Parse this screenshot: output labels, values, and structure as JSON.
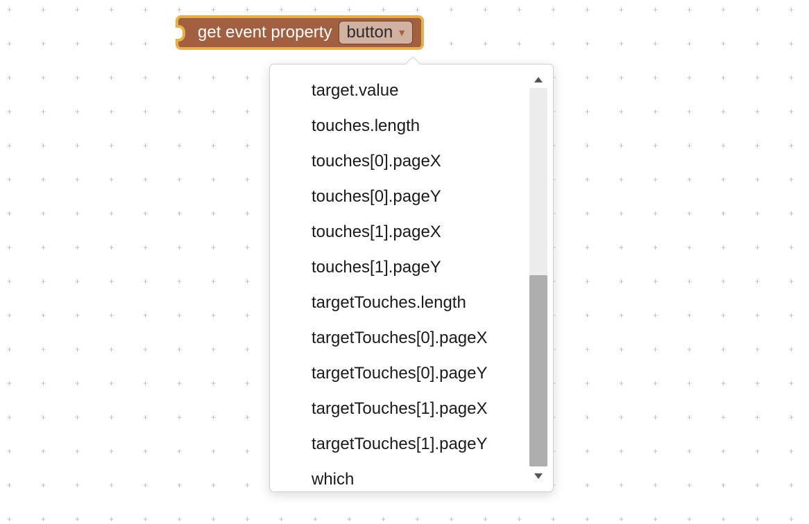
{
  "block": {
    "label": "get event property",
    "selected": "button"
  },
  "menu": {
    "items": [
      "target.value",
      "touches.length",
      "touches[0].pageX",
      "touches[0].pageY",
      "touches[1].pageX",
      "touches[1].pageY",
      "targetTouches.length",
      "targetTouches[0].pageX",
      "targetTouches[0].pageY",
      "targetTouches[1].pageX",
      "targetTouches[1].pageY",
      "which"
    ]
  },
  "grid": {
    "plus_glyph": "+"
  }
}
